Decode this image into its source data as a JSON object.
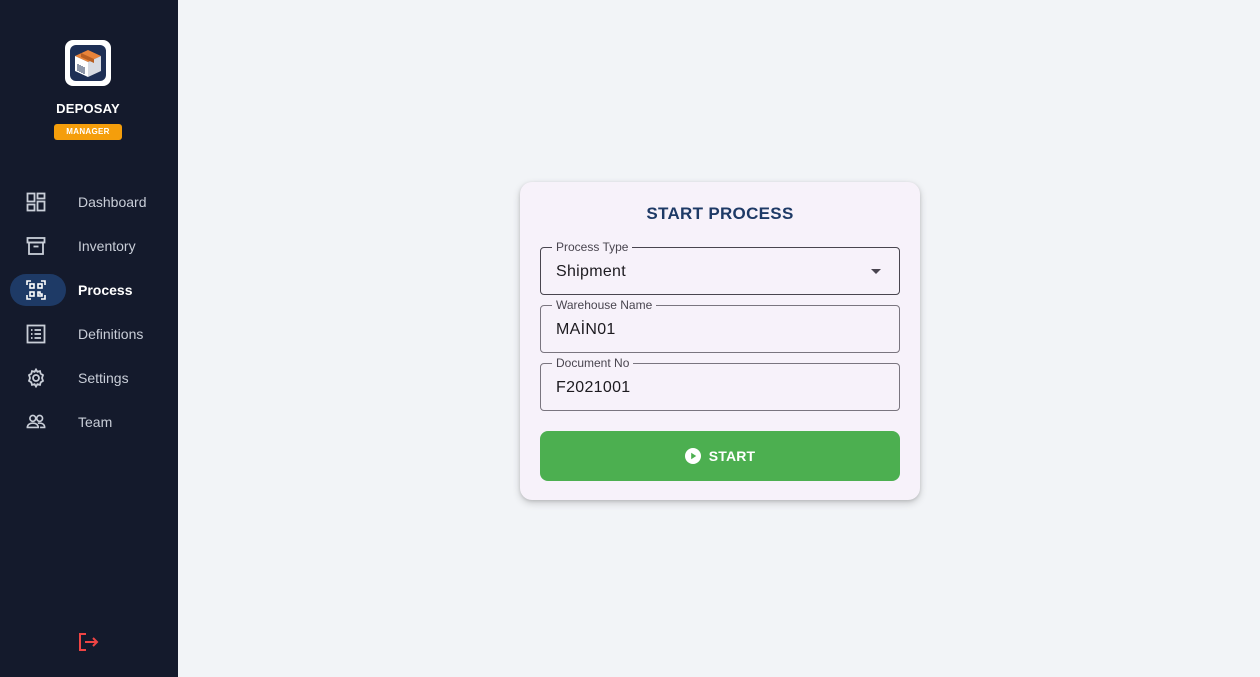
{
  "app": {
    "brand": "DEPOSAY",
    "role_badge": "MANAGER",
    "accent": "#1e3a66",
    "badge_color": "#f59e0b"
  },
  "sidebar": {
    "items": [
      {
        "label": "Dashboard",
        "icon": "dashboard-icon"
      },
      {
        "label": "Inventory",
        "icon": "archive-box-icon"
      },
      {
        "label": "Process",
        "icon": "qr-scan-icon",
        "active": true
      },
      {
        "label": "Definitions",
        "icon": "list-icon"
      },
      {
        "label": "Settings",
        "icon": "gear-icon"
      },
      {
        "label": "Team",
        "icon": "team-icon"
      }
    ],
    "logout_icon": "logout-icon",
    "logout_color": "#ef4444"
  },
  "form": {
    "title": "START PROCESS",
    "process_type": {
      "label": "Process Type",
      "value": "Shipment"
    },
    "warehouse_name": {
      "label": "Warehouse Name",
      "value": "MAİN01"
    },
    "document_no": {
      "label": "Document No",
      "value": "F2021001"
    },
    "start_button": {
      "label": "START",
      "color": "#4caf50",
      "icon": "play-circle-icon"
    }
  }
}
